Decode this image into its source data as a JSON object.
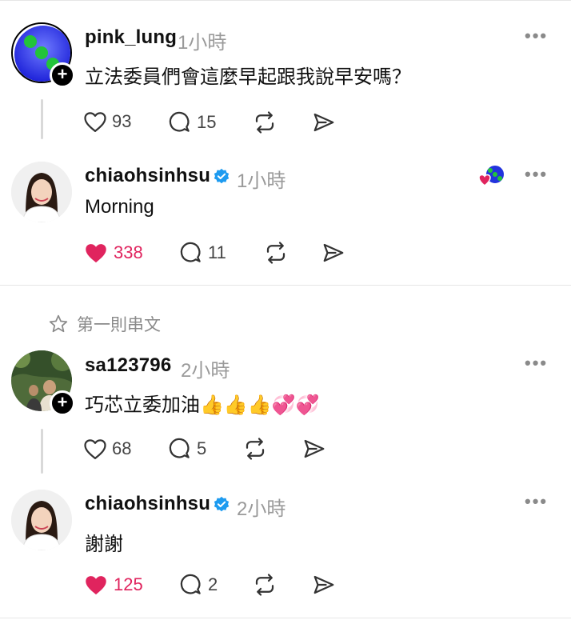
{
  "posts": [
    {
      "username": "pink_lung",
      "time": "1小時",
      "text": "立法委員們會這麼早起跟我說早安嗎？",
      "likes": "93",
      "comments": "15",
      "avatar": "blue-globe-logo",
      "liked": false
    },
    {
      "username": "chiaohsinhsu",
      "time": "1小時",
      "text": "Morning",
      "likes": "338",
      "comments": "11",
      "avatar": "woman-portrait",
      "verified": true,
      "liked": true
    },
    {
      "username": "sa123796",
      "time": "2小時",
      "text": "巧芯立委加油👍👍👍💞💞",
      "likes": "68",
      "comments": "5",
      "avatar": "outdoor-group-photo",
      "liked": false
    },
    {
      "username": "chiaohsinhsu",
      "time": "2小時",
      "text": "謝謝",
      "likes": "125",
      "comments": "2",
      "avatar": "woman-portrait",
      "verified": true,
      "liked": true
    }
  ],
  "thread_label": "第一則串文",
  "more_label": "•••",
  "add_label": "+",
  "colors": {
    "like": "#e0245e",
    "verified": "#1d9bf0",
    "divider": "#e6e6e6"
  },
  "icons": [
    "heart-icon",
    "comment-icon",
    "repost-icon",
    "share-icon",
    "star-icon",
    "more-icon",
    "verified-icon"
  ]
}
